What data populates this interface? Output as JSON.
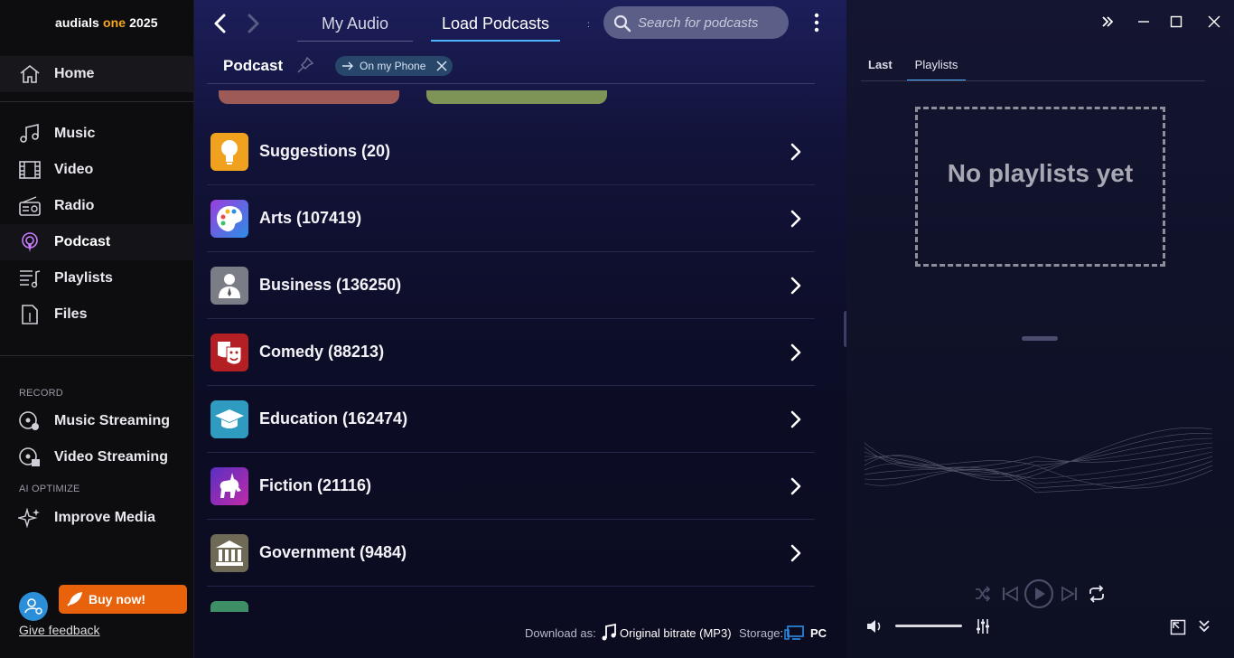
{
  "app": {
    "brand_prefix": "audials ",
    "brand_one": "one",
    "brand_year": " 2025"
  },
  "sidebar": {
    "home": "Home",
    "items": [
      {
        "label": "Music",
        "icon": "music-note-icon"
      },
      {
        "label": "Video",
        "icon": "film-icon"
      },
      {
        "label": "Radio",
        "icon": "radio-icon"
      },
      {
        "label": "Podcast",
        "icon": "podcast-icon",
        "active": true
      },
      {
        "label": "Playlists",
        "icon": "playlist-icon"
      },
      {
        "label": "Files",
        "icon": "file-icon"
      }
    ],
    "record_header": "RECORD",
    "record_items": [
      "Music Streaming",
      "Video Streaming"
    ],
    "optimize_header": "AI OPTIMIZE",
    "optimize_items": [
      "Improve Media"
    ],
    "buy_label": "Buy now!",
    "feedback_label": "Give feedback",
    "accent": "#e8620c"
  },
  "header": {
    "tabs": [
      "My Audio",
      "Load Podcasts"
    ],
    "active_tab": "Load Podcasts",
    "separator": ":",
    "search_placeholder": "Search for podcasts",
    "breadcrumb": "Podcast",
    "chip_label": "On my Phone"
  },
  "categories": [
    {
      "label": "Suggestions (20)",
      "icon": "lightbulb-icon",
      "color": "#f0a21e"
    },
    {
      "label": "Arts (107419)",
      "icon": "palette-icon",
      "color": "#5a5adf"
    },
    {
      "label": "Business (136250)",
      "icon": "businessman-icon",
      "color": "#7a7c86"
    },
    {
      "label": "Comedy (88213)",
      "icon": "theater-masks-icon",
      "color": "#c22727"
    },
    {
      "label": "Education (162474)",
      "icon": "graduation-cap-icon",
      "color": "#2f9bc0"
    },
    {
      "label": "Fiction (21116)",
      "icon": "unicorn-icon",
      "color": "#8a2fc2"
    },
    {
      "label": "Government (9484)",
      "icon": "government-building-icon",
      "color": "#7b7560"
    }
  ],
  "footer": {
    "download_label": "Download as:",
    "download_value": "Original bitrate (MP3)",
    "storage_label": "Storage:",
    "storage_value": "PC"
  },
  "right": {
    "tabs": [
      "Last",
      "Playlists"
    ],
    "active_tab": "Playlists",
    "empty_text": "No playlists yet"
  }
}
